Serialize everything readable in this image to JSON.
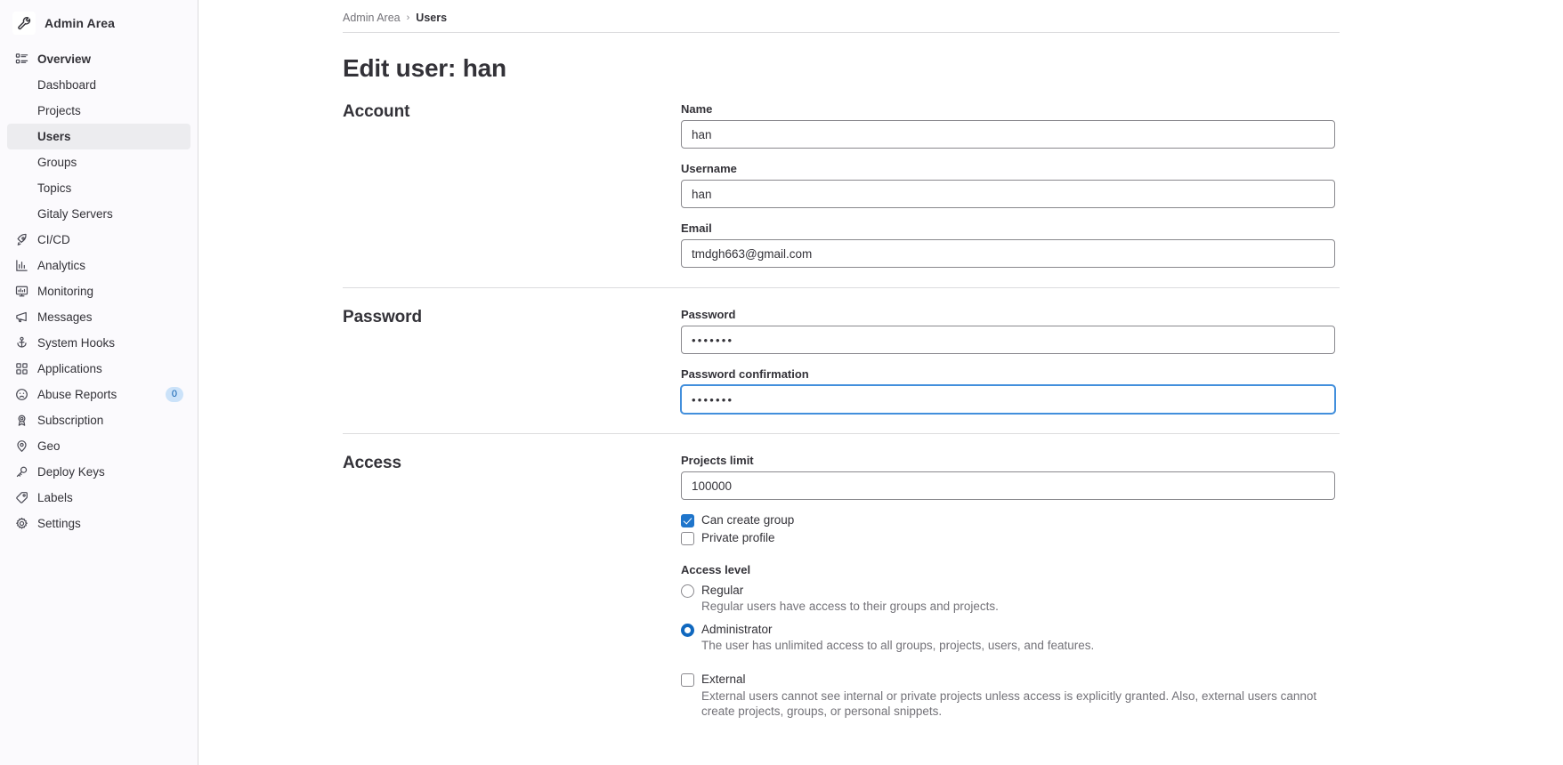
{
  "sidebar": {
    "brand": {
      "label": "Admin Area",
      "icon": "wrench-icon"
    },
    "items": [
      {
        "label": "Overview",
        "icon": "overview-icon",
        "type": "section",
        "active": false
      },
      {
        "label": "Dashboard",
        "icon": "",
        "type": "sub",
        "active": false
      },
      {
        "label": "Projects",
        "icon": "",
        "type": "sub",
        "active": false
      },
      {
        "label": "Users",
        "icon": "",
        "type": "sub",
        "active": true
      },
      {
        "label": "Groups",
        "icon": "",
        "type": "sub",
        "active": false
      },
      {
        "label": "Topics",
        "icon": "",
        "type": "sub",
        "active": false
      },
      {
        "label": "Gitaly Servers",
        "icon": "",
        "type": "sub",
        "active": false
      },
      {
        "label": "CI/CD",
        "icon": "rocket-icon",
        "type": "item",
        "active": false
      },
      {
        "label": "Analytics",
        "icon": "chart-icon",
        "type": "item",
        "active": false
      },
      {
        "label": "Monitoring",
        "icon": "monitor-icon",
        "type": "item",
        "active": false
      },
      {
        "label": "Messages",
        "icon": "megaphone-icon",
        "type": "item",
        "active": false
      },
      {
        "label": "System Hooks",
        "icon": "anchor-icon",
        "type": "item",
        "active": false
      },
      {
        "label": "Applications",
        "icon": "grid-icon",
        "type": "item",
        "active": false
      },
      {
        "label": "Abuse Reports",
        "icon": "sad-face-icon",
        "type": "item",
        "active": false,
        "badge": "0"
      },
      {
        "label": "Subscription",
        "icon": "license-icon",
        "type": "item",
        "active": false
      },
      {
        "label": "Geo",
        "icon": "location-pin-icon",
        "type": "item",
        "active": false
      },
      {
        "label": "Deploy Keys",
        "icon": "key-icon",
        "type": "item",
        "active": false
      },
      {
        "label": "Labels",
        "icon": "label-tag-icon",
        "type": "item",
        "active": false
      },
      {
        "label": "Settings",
        "icon": "gear-icon",
        "type": "item",
        "active": false
      }
    ]
  },
  "breadcrumb": {
    "root": "Admin Area",
    "separator": "›",
    "current": "Users"
  },
  "page": {
    "title": "Edit user: han"
  },
  "sections": {
    "account": {
      "title": "Account",
      "name": {
        "label": "Name",
        "value": "han"
      },
      "username": {
        "label": "Username",
        "value": "han"
      },
      "email": {
        "label": "Email",
        "value": "tmdgh663@gmail.com"
      }
    },
    "password": {
      "title": "Password",
      "password": {
        "label": "Password",
        "value": "•••••••"
      },
      "confirmation": {
        "label": "Password confirmation",
        "value": "•••••••",
        "focused": true
      }
    },
    "access": {
      "title": "Access",
      "projects_limit": {
        "label": "Projects limit",
        "value": "100000"
      },
      "can_create_group": {
        "label": "Can create group",
        "checked": true
      },
      "private_profile": {
        "label": "Private profile",
        "checked": false
      },
      "access_level_label": "Access level",
      "access_levels": [
        {
          "label": "Regular",
          "description": "Regular users have access to their groups and projects.",
          "selected": false
        },
        {
          "label": "Administrator",
          "description": "The user has unlimited access to all groups, projects, users, and features.",
          "selected": true
        }
      ],
      "external": {
        "label": "External",
        "checked": false,
        "description": "External users cannot see internal or private projects unless access is explicitly granted. Also, external users cannot create projects, groups, or personal snippets."
      }
    }
  },
  "colors": {
    "accent": "#1f75cb",
    "focus": "#428fdc",
    "sidebar_bg": "#fbfafd",
    "active_bg": "#ececef",
    "badge_bg": "#cbe2f9",
    "badge_fg": "#0b5cad",
    "muted_text": "#737278",
    "border": "#dcdcde"
  }
}
